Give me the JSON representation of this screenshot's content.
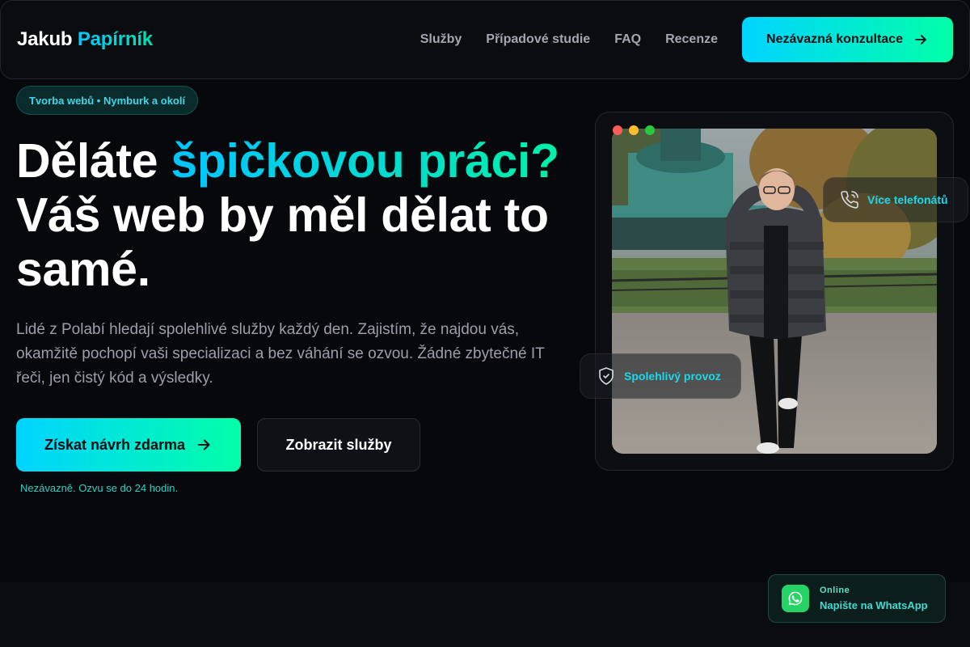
{
  "header": {
    "logo_first": "Jakub",
    "logo_last": "Papírník",
    "nav": [
      {
        "label": "Služby"
      },
      {
        "label": "Případové studie"
      },
      {
        "label": "FAQ"
      },
      {
        "label": "Recenze"
      }
    ],
    "cta_label": "Nezávazná konzultace"
  },
  "badge": "Tvorba webů • Nymburk a okolí",
  "hero": {
    "title_part1": "Děláte ",
    "title_highlight": "špičkovou práci?",
    "title_part2": "Váš web by měl dělat to samé.",
    "description": "Lidé z Polabí hledají spolehlivé služby každý den. Zajistím, že najdou vás, okamžitě pochopí vaši specializaci a bez váhání se ozvou. Žádné zbytečné IT řeči, jen čistý kód a výsledky.",
    "primary_button": "Získat návrh zdarma",
    "secondary_button": "Zobrazit služby",
    "note": "Nezávazně. Ozvu se do 24 hodin."
  },
  "photo_card": {
    "tag_phone": "Více telefonátů",
    "tag_shield": "Spolehlivý provoz"
  },
  "whatsapp": {
    "status": "Online",
    "label": "Napište na WhatsApp"
  },
  "colors": {
    "accent_start": "#00d4ff",
    "accent_end": "#00ffa8",
    "background": "#07080b",
    "dot_red": "#ff5f57",
    "dot_yellow": "#febc2e",
    "dot_green": "#28c840",
    "whatsapp": "#25d366"
  }
}
